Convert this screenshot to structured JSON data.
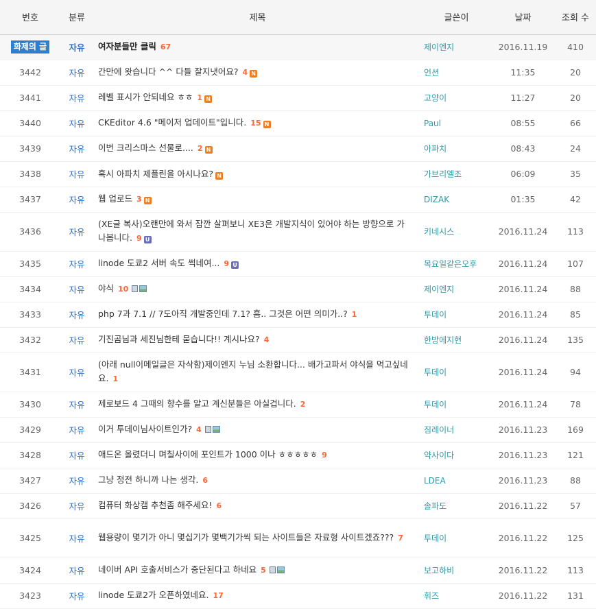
{
  "header": {
    "no": "번호",
    "category": "분류",
    "title": "제목",
    "author": "글쓴이",
    "date": "날짜",
    "views": "조회 수"
  },
  "colors": {
    "accent": "#2e7fd0",
    "comment_count": "#ff6633",
    "author": "#2d9aa8"
  },
  "notice": {
    "badge": "화제의 글",
    "category": "자유",
    "title": "여자분들만 클릭",
    "comments": "67",
    "author": "제이엔지",
    "date": "2016.11.19",
    "views": "410"
  },
  "rows": [
    {
      "no": "3442",
      "category": "자유",
      "title": "간만에 왓습니다 ^^ 다들 잘지냇어요?",
      "comments": "4",
      "icons": [
        "new"
      ],
      "author": "언션",
      "date": "11:35",
      "views": "20"
    },
    {
      "no": "3441",
      "category": "자유",
      "title": "레벨 표시가 안되네요 ㅎㅎ",
      "comments": "1",
      "icons": [
        "new"
      ],
      "author": "고양이",
      "date": "11:27",
      "views": "20"
    },
    {
      "no": "3440",
      "category": "자유",
      "title": "CKEditor 4.6 \"메이저 업데이트\"입니다.",
      "comments": "15",
      "icons": [
        "new"
      ],
      "author": "Paul",
      "date": "08:55",
      "views": "66"
    },
    {
      "no": "3439",
      "category": "자유",
      "title": "이번 크리스마스 선물로....",
      "comments": "2",
      "icons": [
        "new"
      ],
      "author": "아파치",
      "date": "08:43",
      "views": "24"
    },
    {
      "no": "3438",
      "category": "자유",
      "title": "혹시 아파치 제플린을 아시나요?",
      "comments": "",
      "icons": [
        "new"
      ],
      "author": "가브리엘조",
      "date": "06:09",
      "views": "35"
    },
    {
      "no": "3437",
      "category": "자유",
      "title": "웹 업로드",
      "comments": "3",
      "icons": [
        "new"
      ],
      "author": "DIZAK",
      "date": "01:35",
      "views": "42"
    },
    {
      "no": "3436",
      "category": "자유",
      "title": "(XE글 복사)오랜만에 와서 잠깐 살펴보니 XE3은 개발지식이 있어야 하는 방향으로 가나봅니다.",
      "comments": "9",
      "icons": [
        "update"
      ],
      "author": "키네시스",
      "date": "2016.11.24",
      "views": "113",
      "tall": true
    },
    {
      "no": "3435",
      "category": "자유",
      "title": "linode 도쿄2 서버 속도 썩네여...",
      "comments": "9",
      "icons": [
        "update"
      ],
      "author": "목요일같은오후",
      "date": "2016.11.24",
      "views": "107"
    },
    {
      "no": "3434",
      "category": "자유",
      "title": "야식",
      "comments": "10",
      "icons": [
        "file",
        "image"
      ],
      "author": "제이엔지",
      "date": "2016.11.24",
      "views": "88"
    },
    {
      "no": "3433",
      "category": "자유",
      "title": "php 7과 7.1 // 7도아직 개발중인데 7.1? 흠.. 그것은 어떤 의미가..?",
      "comments": "1",
      "icons": [],
      "author": "투데이",
      "date": "2016.11.24",
      "views": "85"
    },
    {
      "no": "3432",
      "category": "자유",
      "title": "기진곰님과 세진님한테 묻습니다!! 계시나요?",
      "comments": "4",
      "icons": [],
      "author": "한방에지현",
      "date": "2016.11.24",
      "views": "135"
    },
    {
      "no": "3431",
      "category": "자유",
      "title": "(아래 null이메일글은 자삭함)제이엔지 누님 소환합니다... 배가고파서 야식을 먹고싶네요.",
      "comments": "1",
      "icons": [],
      "author": "투데이",
      "date": "2016.11.24",
      "views": "94",
      "tall": true
    },
    {
      "no": "3430",
      "category": "자유",
      "title": "제로보드 4 그때의 향수를 알고 계신분들은 아실겁니다.",
      "comments": "2",
      "icons": [],
      "author": "투데이",
      "date": "2016.11.24",
      "views": "78"
    },
    {
      "no": "3429",
      "category": "자유",
      "title": "이거 투데이님사이트인가?",
      "comments": "4",
      "icons": [
        "file",
        "image"
      ],
      "author": "짐레이너",
      "date": "2016.11.23",
      "views": "169"
    },
    {
      "no": "3428",
      "category": "자유",
      "title": "애드온 올렸더니 며칠사이에 포인트가 1000 이나 ㅎㅎㅎㅎㅎ",
      "comments": "9",
      "icons": [],
      "author": "약사이다",
      "date": "2016.11.23",
      "views": "121"
    },
    {
      "no": "3427",
      "category": "자유",
      "title": "그냥 정전 하니까 나는 생각.",
      "comments": "6",
      "icons": [],
      "author": "LDEA",
      "date": "2016.11.23",
      "views": "88"
    },
    {
      "no": "3426",
      "category": "자유",
      "title": "컴퓨터 화상캠 추천좀 해주세요!",
      "comments": "6",
      "icons": [],
      "author": "솔파도",
      "date": "2016.11.22",
      "views": "57"
    },
    {
      "no": "3425",
      "category": "자유",
      "title": "웹용량이 몇기가 아니 몇십기가 몇백기가씩 되는 사이트들은 자료형 사이트겠죠???",
      "comments": "7",
      "icons": [],
      "author": "투데이",
      "date": "2016.11.22",
      "views": "125",
      "tall": true
    },
    {
      "no": "3424",
      "category": "자유",
      "title": "네이버 API 호출서비스가 중단된다고 하네요",
      "comments": "5",
      "icons": [
        "file",
        "image"
      ],
      "author": "보고하비",
      "date": "2016.11.22",
      "views": "113"
    },
    {
      "no": "3423",
      "category": "자유",
      "title": "linode 도쿄2가 오픈하였네요.",
      "comments": "17",
      "icons": [],
      "author": "휘즈",
      "date": "2016.11.22",
      "views": "131"
    }
  ]
}
